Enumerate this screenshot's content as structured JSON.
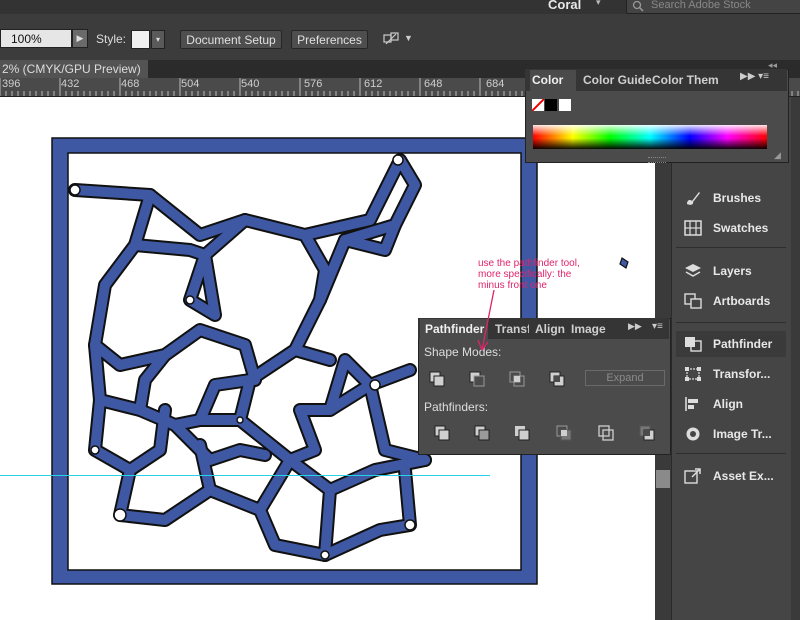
{
  "top": {
    "workspace": "Coral",
    "stock_search_placeholder": "Search Adobe Stock"
  },
  "control_bar": {
    "zoom_value": "100%",
    "style_label": "Style:",
    "document_setup": "Document Setup",
    "preferences": "Preferences"
  },
  "document": {
    "tab_title": "2% (CMYK/GPU Preview)"
  },
  "ruler": {
    "ticks": [
      "396",
      "432",
      "468",
      "504",
      "540",
      "576",
      "612",
      "648",
      "684"
    ]
  },
  "color_panel": {
    "tabs": [
      "Color",
      "Color Guide",
      "Color Them"
    ]
  },
  "pathfinder_panel": {
    "tabs": [
      "Pathfinder",
      "Transf",
      "Align",
      "Image"
    ],
    "shape_modes_label": "Shape Modes:",
    "pathfinders_label": "Pathfinders:",
    "expand_label": "Expand"
  },
  "dock": {
    "items": [
      "Brushes",
      "Swatches",
      "Layers",
      "Artboards",
      "Pathfinder",
      "Transfor...",
      "Align",
      "Image Tr...",
      "Asset Ex..."
    ]
  },
  "annotation": {
    "line1": "use the pathfinder tool,",
    "line2": "more specifically: the",
    "line3": "minus front one"
  },
  "colors": {
    "art_fill": "#3f58a3",
    "guide": "#27d2e6",
    "annotation": "#e0246a"
  }
}
